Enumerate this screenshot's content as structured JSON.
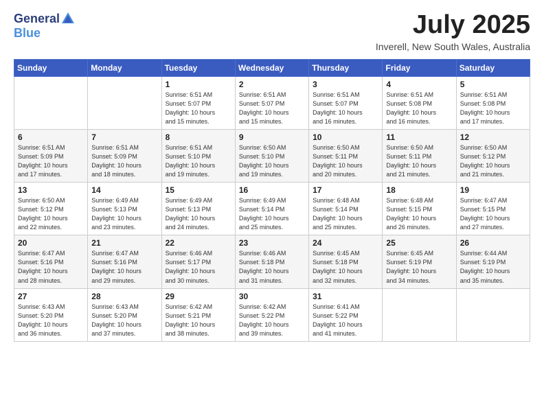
{
  "logo": {
    "general": "General",
    "blue": "Blue"
  },
  "title": "July 2025",
  "subtitle": "Inverell, New South Wales, Australia",
  "days_of_week": [
    "Sunday",
    "Monday",
    "Tuesday",
    "Wednesday",
    "Thursday",
    "Friday",
    "Saturday"
  ],
  "weeks": [
    [
      {
        "day": "",
        "info": ""
      },
      {
        "day": "",
        "info": ""
      },
      {
        "day": "1",
        "info": "Sunrise: 6:51 AM\nSunset: 5:07 PM\nDaylight: 10 hours\nand 15 minutes."
      },
      {
        "day": "2",
        "info": "Sunrise: 6:51 AM\nSunset: 5:07 PM\nDaylight: 10 hours\nand 15 minutes."
      },
      {
        "day": "3",
        "info": "Sunrise: 6:51 AM\nSunset: 5:07 PM\nDaylight: 10 hours\nand 16 minutes."
      },
      {
        "day": "4",
        "info": "Sunrise: 6:51 AM\nSunset: 5:08 PM\nDaylight: 10 hours\nand 16 minutes."
      },
      {
        "day": "5",
        "info": "Sunrise: 6:51 AM\nSunset: 5:08 PM\nDaylight: 10 hours\nand 17 minutes."
      }
    ],
    [
      {
        "day": "6",
        "info": "Sunrise: 6:51 AM\nSunset: 5:09 PM\nDaylight: 10 hours\nand 17 minutes."
      },
      {
        "day": "7",
        "info": "Sunrise: 6:51 AM\nSunset: 5:09 PM\nDaylight: 10 hours\nand 18 minutes."
      },
      {
        "day": "8",
        "info": "Sunrise: 6:51 AM\nSunset: 5:10 PM\nDaylight: 10 hours\nand 19 minutes."
      },
      {
        "day": "9",
        "info": "Sunrise: 6:50 AM\nSunset: 5:10 PM\nDaylight: 10 hours\nand 19 minutes."
      },
      {
        "day": "10",
        "info": "Sunrise: 6:50 AM\nSunset: 5:11 PM\nDaylight: 10 hours\nand 20 minutes."
      },
      {
        "day": "11",
        "info": "Sunrise: 6:50 AM\nSunset: 5:11 PM\nDaylight: 10 hours\nand 21 minutes."
      },
      {
        "day": "12",
        "info": "Sunrise: 6:50 AM\nSunset: 5:12 PM\nDaylight: 10 hours\nand 21 minutes."
      }
    ],
    [
      {
        "day": "13",
        "info": "Sunrise: 6:50 AM\nSunset: 5:12 PM\nDaylight: 10 hours\nand 22 minutes."
      },
      {
        "day": "14",
        "info": "Sunrise: 6:49 AM\nSunset: 5:13 PM\nDaylight: 10 hours\nand 23 minutes."
      },
      {
        "day": "15",
        "info": "Sunrise: 6:49 AM\nSunset: 5:13 PM\nDaylight: 10 hours\nand 24 minutes."
      },
      {
        "day": "16",
        "info": "Sunrise: 6:49 AM\nSunset: 5:14 PM\nDaylight: 10 hours\nand 25 minutes."
      },
      {
        "day": "17",
        "info": "Sunrise: 6:48 AM\nSunset: 5:14 PM\nDaylight: 10 hours\nand 25 minutes."
      },
      {
        "day": "18",
        "info": "Sunrise: 6:48 AM\nSunset: 5:15 PM\nDaylight: 10 hours\nand 26 minutes."
      },
      {
        "day": "19",
        "info": "Sunrise: 6:47 AM\nSunset: 5:15 PM\nDaylight: 10 hours\nand 27 minutes."
      }
    ],
    [
      {
        "day": "20",
        "info": "Sunrise: 6:47 AM\nSunset: 5:16 PM\nDaylight: 10 hours\nand 28 minutes."
      },
      {
        "day": "21",
        "info": "Sunrise: 6:47 AM\nSunset: 5:16 PM\nDaylight: 10 hours\nand 29 minutes."
      },
      {
        "day": "22",
        "info": "Sunrise: 6:46 AM\nSunset: 5:17 PM\nDaylight: 10 hours\nand 30 minutes."
      },
      {
        "day": "23",
        "info": "Sunrise: 6:46 AM\nSunset: 5:18 PM\nDaylight: 10 hours\nand 31 minutes."
      },
      {
        "day": "24",
        "info": "Sunrise: 6:45 AM\nSunset: 5:18 PM\nDaylight: 10 hours\nand 32 minutes."
      },
      {
        "day": "25",
        "info": "Sunrise: 6:45 AM\nSunset: 5:19 PM\nDaylight: 10 hours\nand 34 minutes."
      },
      {
        "day": "26",
        "info": "Sunrise: 6:44 AM\nSunset: 5:19 PM\nDaylight: 10 hours\nand 35 minutes."
      }
    ],
    [
      {
        "day": "27",
        "info": "Sunrise: 6:43 AM\nSunset: 5:20 PM\nDaylight: 10 hours\nand 36 minutes."
      },
      {
        "day": "28",
        "info": "Sunrise: 6:43 AM\nSunset: 5:20 PM\nDaylight: 10 hours\nand 37 minutes."
      },
      {
        "day": "29",
        "info": "Sunrise: 6:42 AM\nSunset: 5:21 PM\nDaylight: 10 hours\nand 38 minutes."
      },
      {
        "day": "30",
        "info": "Sunrise: 6:42 AM\nSunset: 5:22 PM\nDaylight: 10 hours\nand 39 minutes."
      },
      {
        "day": "31",
        "info": "Sunrise: 6:41 AM\nSunset: 5:22 PM\nDaylight: 10 hours\nand 41 minutes."
      },
      {
        "day": "",
        "info": ""
      },
      {
        "day": "",
        "info": ""
      }
    ]
  ]
}
